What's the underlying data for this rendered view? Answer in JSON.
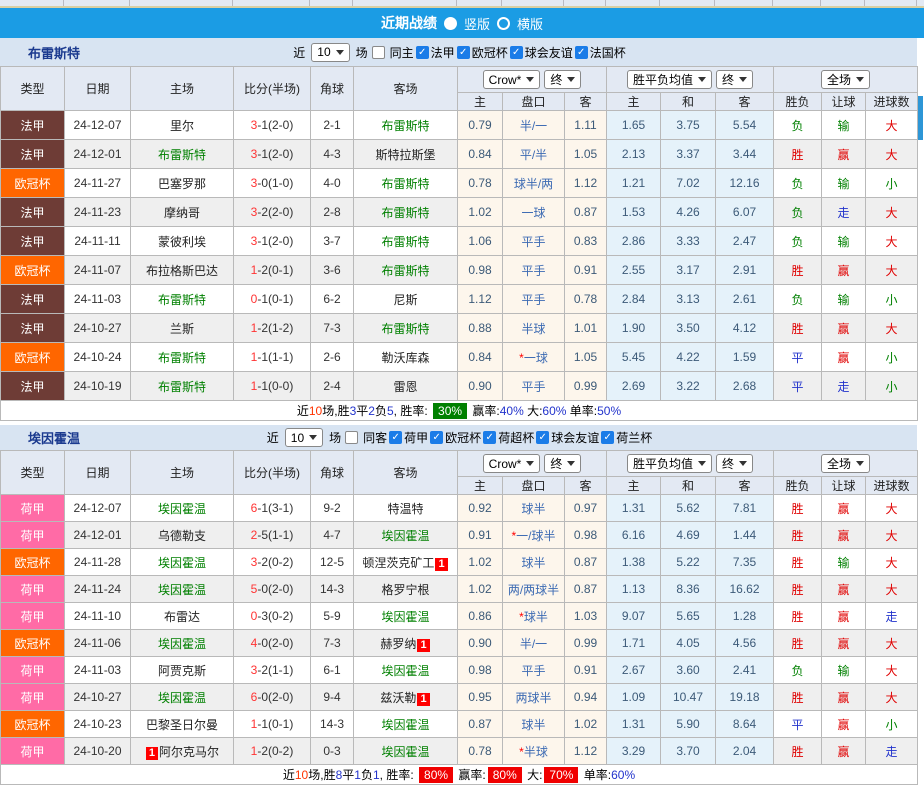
{
  "title_bar": {
    "title": "近期战绩",
    "options": [
      {
        "label": "竖版",
        "selected": true
      },
      {
        "label": "横版",
        "selected": false
      }
    ]
  },
  "partial_header_cells": [
    "",
    "",
    "",
    "",
    "",
    "",
    "主",
    "盘口",
    "客",
    "主",
    "和",
    "客",
    "",
    "",
    ""
  ],
  "colors": {
    "accent_blue": "#1b9ce4",
    "league": {
      "法甲": "#6e3c36",
      "欧冠杯": "#ff6600",
      "荷甲": "#ff6ba6"
    },
    "focal_team": "#008000",
    "result": {
      "胜": "#e00000",
      "负": "#008000",
      "平": "#2233cc",
      "赢": "#e00000",
      "输": "#008000",
      "走": "#2233cc",
      "大": "#e00000",
      "小": "#008000"
    }
  },
  "table_header": {
    "static_cols": [
      "类型",
      "日期",
      "主场",
      "比分(半场)",
      "角球",
      "客场"
    ],
    "odds_select": "Crow*",
    "odds_final_select": "终",
    "avg_select": "胜平负均值",
    "avg_final_select": "终",
    "scope_select": "全场",
    "odds_sub": [
      "主",
      "盘口",
      "客"
    ],
    "avg_sub": [
      "主",
      "和",
      "客"
    ],
    "result_sub": [
      "胜负",
      "让球",
      "进球数"
    ]
  },
  "sections": [
    {
      "team": "布雷斯特",
      "filter": {
        "near": "近",
        "count": "10",
        "unit": "场",
        "same": {
          "label": "同主",
          "checked": false
        },
        "competitions": [
          {
            "label": "法甲",
            "checked": true
          },
          {
            "label": "欧冠杯",
            "checked": true
          },
          {
            "label": "球会友谊",
            "checked": true
          },
          {
            "label": "法国杯",
            "checked": true
          }
        ]
      },
      "rows": [
        {
          "league": "法甲",
          "date": "24-12-07",
          "home": "里尔",
          "home_focal": false,
          "home_badge": "",
          "home_badge_pos": "",
          "score_main": "3",
          "score_rest": "-1(2-0)",
          "corner": "2-1",
          "away": "布雷斯特",
          "away_focal": true,
          "away_badge": "",
          "odds_home": "0.79",
          "handicap": "半/一",
          "handicap_star": false,
          "odds_away": "1.11",
          "avg_home": "1.65",
          "avg_draw": "3.75",
          "avg_away": "5.54",
          "wdl": "负",
          "let_res": "输",
          "goal_res": "大"
        },
        {
          "league": "法甲",
          "date": "24-12-01",
          "home": "布雷斯特",
          "home_focal": true,
          "home_badge": "",
          "home_badge_pos": "",
          "score_main": "3",
          "score_rest": "-1(2-0)",
          "corner": "4-3",
          "away": "斯特拉斯堡",
          "away_focal": false,
          "away_badge": "",
          "odds_home": "0.84",
          "handicap": "平/半",
          "handicap_star": false,
          "odds_away": "1.05",
          "avg_home": "2.13",
          "avg_draw": "3.37",
          "avg_away": "3.44",
          "wdl": "胜",
          "let_res": "赢",
          "goal_res": "大"
        },
        {
          "league": "欧冠杯",
          "date": "24-11-27",
          "home": "巴塞罗那",
          "home_focal": false,
          "home_badge": "",
          "home_badge_pos": "",
          "score_main": "3",
          "score_rest": "-0(1-0)",
          "corner": "4-0",
          "away": "布雷斯特",
          "away_focal": true,
          "away_badge": "",
          "odds_home": "0.78",
          "handicap": "球半/两",
          "handicap_star": false,
          "odds_away": "1.12",
          "avg_home": "1.21",
          "avg_draw": "7.02",
          "avg_away": "12.16",
          "wdl": "负",
          "let_res": "输",
          "goal_res": "小"
        },
        {
          "league": "法甲",
          "date": "24-11-23",
          "home": "摩纳哥",
          "home_focal": false,
          "home_badge": "",
          "home_badge_pos": "",
          "score_main": "3",
          "score_rest": "-2(2-0)",
          "corner": "2-8",
          "away": "布雷斯特",
          "away_focal": true,
          "away_badge": "",
          "odds_home": "1.02",
          "handicap": "一球",
          "handicap_star": false,
          "odds_away": "0.87",
          "avg_home": "1.53",
          "avg_draw": "4.26",
          "avg_away": "6.07",
          "wdl": "负",
          "let_res": "走",
          "goal_res": "大"
        },
        {
          "league": "法甲",
          "date": "24-11-11",
          "home": "蒙彼利埃",
          "home_focal": false,
          "home_badge": "",
          "home_badge_pos": "",
          "score_main": "3",
          "score_rest": "-1(2-0)",
          "corner": "3-7",
          "away": "布雷斯特",
          "away_focal": true,
          "away_badge": "",
          "odds_home": "1.06",
          "handicap": "平手",
          "handicap_star": false,
          "odds_away": "0.83",
          "avg_home": "2.86",
          "avg_draw": "3.33",
          "avg_away": "2.47",
          "wdl": "负",
          "let_res": "输",
          "goal_res": "大"
        },
        {
          "league": "欧冠杯",
          "date": "24-11-07",
          "home": "布拉格斯巴达",
          "home_focal": false,
          "home_badge": "",
          "home_badge_pos": "",
          "score_main": "1",
          "score_rest": "-2(0-1)",
          "corner": "3-6",
          "away": "布雷斯特",
          "away_focal": true,
          "away_badge": "",
          "odds_home": "0.98",
          "handicap": "平手",
          "handicap_star": false,
          "odds_away": "0.91",
          "avg_home": "2.55",
          "avg_draw": "3.17",
          "avg_away": "2.91",
          "wdl": "胜",
          "let_res": "赢",
          "goal_res": "大"
        },
        {
          "league": "法甲",
          "date": "24-11-03",
          "home": "布雷斯特",
          "home_focal": true,
          "home_badge": "",
          "home_badge_pos": "",
          "score_main": "0",
          "score_rest": "-1(0-1)",
          "corner": "6-2",
          "away": "尼斯",
          "away_focal": false,
          "away_badge": "",
          "odds_home": "1.12",
          "handicap": "平手",
          "handicap_star": false,
          "odds_away": "0.78",
          "avg_home": "2.84",
          "avg_draw": "3.13",
          "avg_away": "2.61",
          "wdl": "负",
          "let_res": "输",
          "goal_res": "小"
        },
        {
          "league": "法甲",
          "date": "24-10-27",
          "home": "兰斯",
          "home_focal": false,
          "home_badge": "",
          "home_badge_pos": "",
          "score_main": "1",
          "score_rest": "-2(1-2)",
          "corner": "7-3",
          "away": "布雷斯特",
          "away_focal": true,
          "away_badge": "",
          "odds_home": "0.88",
          "handicap": "半球",
          "handicap_star": false,
          "odds_away": "1.01",
          "avg_home": "1.90",
          "avg_draw": "3.50",
          "avg_away": "4.12",
          "wdl": "胜",
          "let_res": "赢",
          "goal_res": "大"
        },
        {
          "league": "欧冠杯",
          "date": "24-10-24",
          "home": "布雷斯特",
          "home_focal": true,
          "home_badge": "",
          "home_badge_pos": "",
          "score_main": "1",
          "score_rest": "-1(1-1)",
          "corner": "2-6",
          "away": "勒沃库森",
          "away_focal": false,
          "away_badge": "",
          "odds_home": "0.84",
          "handicap": "一球",
          "handicap_star": true,
          "odds_away": "1.05",
          "avg_home": "5.45",
          "avg_draw": "4.22",
          "avg_away": "1.59",
          "wdl": "平",
          "let_res": "赢",
          "goal_res": "小"
        },
        {
          "league": "法甲",
          "date": "24-10-19",
          "home": "布雷斯特",
          "home_focal": true,
          "home_badge": "",
          "home_badge_pos": "",
          "score_main": "1",
          "score_rest": "-1(0-0)",
          "corner": "2-4",
          "away": "雷恩",
          "away_focal": false,
          "away_badge": "",
          "odds_home": "0.90",
          "handicap": "平手",
          "handicap_star": false,
          "odds_away": "0.99",
          "avg_home": "2.69",
          "avg_draw": "3.22",
          "avg_away": "2.68",
          "wdl": "平",
          "let_res": "走",
          "goal_res": "小"
        }
      ],
      "summary": [
        {
          "t": "近",
          "s": "p"
        },
        {
          "t": "10",
          "s": "r"
        },
        {
          "t": "场,胜",
          "s": "p"
        },
        {
          "t": "3",
          "s": "b"
        },
        {
          "t": "平",
          "s": "p"
        },
        {
          "t": "2",
          "s": "b"
        },
        {
          "t": "负",
          "s": "p"
        },
        {
          "t": "5",
          "s": "b"
        },
        {
          "t": ", 胜率: ",
          "s": "p"
        },
        {
          "t": "30%",
          "s": "gb"
        },
        {
          "t": " 赢率:",
          "s": "p"
        },
        {
          "t": "40%",
          "s": "b"
        },
        {
          "t": " 大:",
          "s": "p"
        },
        {
          "t": "60%",
          "s": "b"
        },
        {
          "t": " 单率:",
          "s": "p"
        },
        {
          "t": "50%",
          "s": "b"
        }
      ]
    },
    {
      "team": "埃因霍温",
      "filter": {
        "near": "近",
        "count": "10",
        "unit": "场",
        "same": {
          "label": "同客",
          "checked": false
        },
        "competitions": [
          {
            "label": "荷甲",
            "checked": true
          },
          {
            "label": "欧冠杯",
            "checked": true
          },
          {
            "label": "荷超杯",
            "checked": true
          },
          {
            "label": "球会友谊",
            "checked": true
          },
          {
            "label": "荷兰杯",
            "checked": true
          }
        ]
      },
      "rows": [
        {
          "league": "荷甲",
          "date": "24-12-07",
          "home": "埃因霍温",
          "home_focal": true,
          "home_badge": "",
          "home_badge_pos": "",
          "score_main": "6",
          "score_rest": "-1(3-1)",
          "corner": "9-2",
          "away": "特温特",
          "away_focal": false,
          "away_badge": "",
          "odds_home": "0.92",
          "handicap": "球半",
          "handicap_star": false,
          "odds_away": "0.97",
          "avg_home": "1.31",
          "avg_draw": "5.62",
          "avg_away": "7.81",
          "wdl": "胜",
          "let_res": "赢",
          "goal_res": "大"
        },
        {
          "league": "荷甲",
          "date": "24-12-01",
          "home": "乌德勒支",
          "home_focal": false,
          "home_badge": "",
          "home_badge_pos": "",
          "score_main": "2",
          "score_rest": "-5(1-1)",
          "corner": "4-7",
          "away": "埃因霍温",
          "away_focal": true,
          "away_badge": "",
          "odds_home": "0.91",
          "handicap": "一/球半",
          "handicap_star": true,
          "odds_away": "0.98",
          "avg_home": "6.16",
          "avg_draw": "4.69",
          "avg_away": "1.44",
          "wdl": "胜",
          "let_res": "赢",
          "goal_res": "大"
        },
        {
          "league": "欧冠杯",
          "date": "24-11-28",
          "home": "埃因霍温",
          "home_focal": true,
          "home_badge": "",
          "home_badge_pos": "",
          "score_main": "3",
          "score_rest": "-2(0-2)",
          "corner": "12-5",
          "away": "顿涅茨克矿工",
          "away_focal": false,
          "away_badge": "1",
          "odds_home": "1.02",
          "handicap": "球半",
          "handicap_star": false,
          "odds_away": "0.87",
          "avg_home": "1.38",
          "avg_draw": "5.22",
          "avg_away": "7.35",
          "wdl": "胜",
          "let_res": "输",
          "goal_res": "大"
        },
        {
          "league": "荷甲",
          "date": "24-11-24",
          "home": "埃因霍温",
          "home_focal": true,
          "home_badge": "",
          "home_badge_pos": "",
          "score_main": "5",
          "score_rest": "-0(2-0)",
          "corner": "14-3",
          "away": "格罗宁根",
          "away_focal": false,
          "away_badge": "",
          "odds_home": "1.02",
          "handicap": "两/两球半",
          "handicap_star": false,
          "odds_away": "0.87",
          "avg_home": "1.13",
          "avg_draw": "8.36",
          "avg_away": "16.62",
          "wdl": "胜",
          "let_res": "赢",
          "goal_res": "大"
        },
        {
          "league": "荷甲",
          "date": "24-11-10",
          "home": "布雷达",
          "home_focal": false,
          "home_badge": "",
          "home_badge_pos": "",
          "score_main": "0",
          "score_rest": "-3(0-2)",
          "corner": "5-9",
          "away": "埃因霍温",
          "away_focal": true,
          "away_badge": "",
          "odds_home": "0.86",
          "handicap": "球半",
          "handicap_star": true,
          "odds_away": "1.03",
          "avg_home": "9.07",
          "avg_draw": "5.65",
          "avg_away": "1.28",
          "wdl": "胜",
          "let_res": "赢",
          "goal_res": "走"
        },
        {
          "league": "欧冠杯",
          "date": "24-11-06",
          "home": "埃因霍温",
          "home_focal": true,
          "home_badge": "",
          "home_badge_pos": "",
          "score_main": "4",
          "score_rest": "-0(2-0)",
          "corner": "7-3",
          "away": "赫罗纳",
          "away_focal": false,
          "away_badge": "1",
          "odds_home": "0.90",
          "handicap": "半/一",
          "handicap_star": false,
          "odds_away": "0.99",
          "avg_home": "1.71",
          "avg_draw": "4.05",
          "avg_away": "4.56",
          "wdl": "胜",
          "let_res": "赢",
          "goal_res": "大"
        },
        {
          "league": "荷甲",
          "date": "24-11-03",
          "home": "阿贾克斯",
          "home_focal": false,
          "home_badge": "",
          "home_badge_pos": "",
          "score_main": "3",
          "score_rest": "-2(1-1)",
          "corner": "6-1",
          "away": "埃因霍温",
          "away_focal": true,
          "away_badge": "",
          "odds_home": "0.98",
          "handicap": "平手",
          "handicap_star": false,
          "odds_away": "0.91",
          "avg_home": "2.67",
          "avg_draw": "3.60",
          "avg_away": "2.41",
          "wdl": "负",
          "let_res": "输",
          "goal_res": "大"
        },
        {
          "league": "荷甲",
          "date": "24-10-27",
          "home": "埃因霍温",
          "home_focal": true,
          "home_badge": "",
          "home_badge_pos": "",
          "score_main": "6",
          "score_rest": "-0(2-0)",
          "corner": "9-4",
          "away": "兹沃勒",
          "away_focal": false,
          "away_badge": "1",
          "odds_home": "0.95",
          "handicap": "两球半",
          "handicap_star": false,
          "odds_away": "0.94",
          "avg_home": "1.09",
          "avg_draw": "10.47",
          "avg_away": "19.18",
          "wdl": "胜",
          "let_res": "赢",
          "goal_res": "大"
        },
        {
          "league": "欧冠杯",
          "date": "24-10-23",
          "home": "巴黎圣日尔曼",
          "home_focal": false,
          "home_badge": "",
          "home_badge_pos": "",
          "score_main": "1",
          "score_rest": "-1(0-1)",
          "corner": "14-3",
          "away": "埃因霍温",
          "away_focal": true,
          "away_badge": "",
          "odds_home": "0.87",
          "handicap": "球半",
          "handicap_star": false,
          "odds_away": "1.02",
          "avg_home": "1.31",
          "avg_draw": "5.90",
          "avg_away": "8.64",
          "wdl": "平",
          "let_res": "赢",
          "goal_res": "小"
        },
        {
          "league": "荷甲",
          "date": "24-10-20",
          "home": "阿尔克马尔",
          "home_focal": false,
          "home_badge": "1",
          "home_badge_pos": "pre",
          "score_main": "1",
          "score_rest": "-2(0-2)",
          "corner": "0-3",
          "away": "埃因霍温",
          "away_focal": true,
          "away_badge": "",
          "odds_home": "0.78",
          "handicap": "半球",
          "handicap_star": true,
          "odds_away": "1.12",
          "avg_home": "3.29",
          "avg_draw": "3.70",
          "avg_away": "2.04",
          "wdl": "胜",
          "let_res": "赢",
          "goal_res": "走"
        }
      ],
      "summary": [
        {
          "t": "近",
          "s": "p"
        },
        {
          "t": "10",
          "s": "r"
        },
        {
          "t": "场,胜",
          "s": "p"
        },
        {
          "t": "8",
          "s": "b"
        },
        {
          "t": "平",
          "s": "p"
        },
        {
          "t": "1",
          "s": "b"
        },
        {
          "t": "负",
          "s": "p"
        },
        {
          "t": "1",
          "s": "b"
        },
        {
          "t": ", 胜率: ",
          "s": "p"
        },
        {
          "t": "80%",
          "s": "rb"
        },
        {
          "t": " 赢率:",
          "s": "p"
        },
        {
          "t": "80%",
          "s": "rb"
        },
        {
          "t": " 大:",
          "s": "p"
        },
        {
          "t": "70%",
          "s": "rb"
        },
        {
          "t": " 单率:",
          "s": "p"
        },
        {
          "t": "60%",
          "s": "b"
        }
      ]
    }
  ]
}
